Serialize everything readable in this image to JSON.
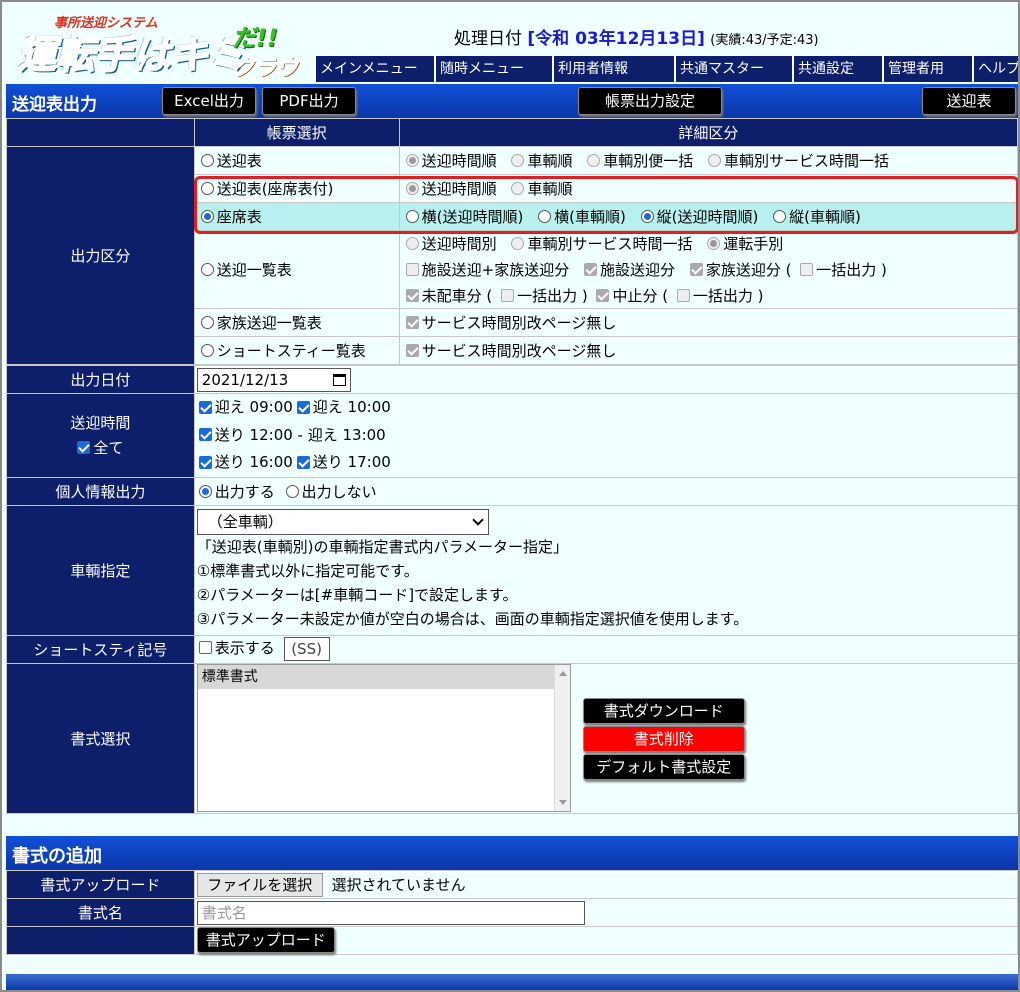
{
  "header": {
    "logo_sub": "事所送迎システム",
    "logo_main": "運転手はキミ",
    "logo_da": "だ!!",
    "logo_cloud": "クラウド",
    "proc_label": "処理日付",
    "proc_date": "[令和 03年12月13日]",
    "proc_count": "(実績:43/予定:43)",
    "menu": [
      "メインメニュー",
      "随時メニュー",
      "利用者情報",
      "共通マスター",
      "共通設定",
      "管理者用",
      "ヘルプ"
    ]
  },
  "titlebar": {
    "title": "送迎表出力",
    "excel": "Excel出力",
    "pdf": "PDF出力",
    "settings": "帳票出力設定",
    "sogei": "送迎表"
  },
  "table_head": {
    "col1": "帳票選択",
    "col2": "詳細区分"
  },
  "output_section": {
    "label": "出力区分",
    "rows": {
      "r1": {
        "name": "送迎表",
        "opts": [
          "送迎時間順",
          "車輌順",
          "車輌別便一括",
          "車輌別サービス時間一括"
        ]
      },
      "r2": {
        "name": "送迎表(座席表付)",
        "opts": [
          "送迎時間順",
          "車輌順"
        ]
      },
      "r3": {
        "name": "座席表",
        "opts": [
          "横(送迎時間順)",
          "横(車輌順)",
          "縦(送迎時間順)",
          "縦(車輌順)"
        ]
      },
      "r4": {
        "name": "送迎一覧表",
        "line1": [
          "送迎時間別",
          "車輌別サービス時間一括",
          "運転手別"
        ],
        "line2": [
          "施設送迎+家族送迎分",
          "施設送迎分",
          "家族送迎分 (",
          "一括出力 )"
        ],
        "line3": [
          "未配車分 (",
          "一括出力 )",
          "中止分 (",
          "一括出力 )"
        ]
      },
      "r5": {
        "name": "家族送迎一覧表",
        "opt": "サービス時間別改ページ無し"
      },
      "r6": {
        "name": "ショートスティー覧表",
        "opt": "サービス時間別改ページ無し"
      }
    }
  },
  "date_row": {
    "label": "出力日付",
    "value": "2021/12/13"
  },
  "time_row": {
    "label": "送迎時間",
    "all": "全て",
    "items": [
      "迎え 09:00",
      "迎え 10:00",
      "送り 12:00 - 迎え 13:00",
      "送り 16:00",
      "送り 17:00"
    ]
  },
  "personal_row": {
    "label": "個人情報出力",
    "yes": "出力する",
    "no": "出力しない"
  },
  "vehicle_row": {
    "label": "車輌指定",
    "selected": "（全車輌）",
    "note1": "「送迎表(車輌別)の車輌指定書式内パラメーター指定」",
    "note2": "①標準書式以外に指定可能です。",
    "note3": "②パラメーターは[#車輌コード]で設定します。",
    "note4": "③パラメーター未設定か値が空白の場合は、画面の車輌指定選択値を使用します。"
  },
  "short_row": {
    "label": "ショートスティ記号",
    "show": "表示する",
    "code": "(SS)"
  },
  "format_row": {
    "label": "書式選択",
    "items": [
      "標準書式"
    ],
    "download": "書式ダウンロード",
    "delete": "書式削除",
    "default": "デフォルト書式設定"
  },
  "add_section": {
    "title": "書式の追加",
    "upload_label": "書式アップロード",
    "file_button": "ファイルを選択",
    "file_status": "選択されていません",
    "name_label": "書式名",
    "name_placeholder": "書式名",
    "upload_button": "書式アップロード"
  },
  "colors": {
    "navy": "#0d1f6b",
    "blue": "#1050d8",
    "highlight": "#b8f0f0",
    "red": "#ff0000"
  }
}
